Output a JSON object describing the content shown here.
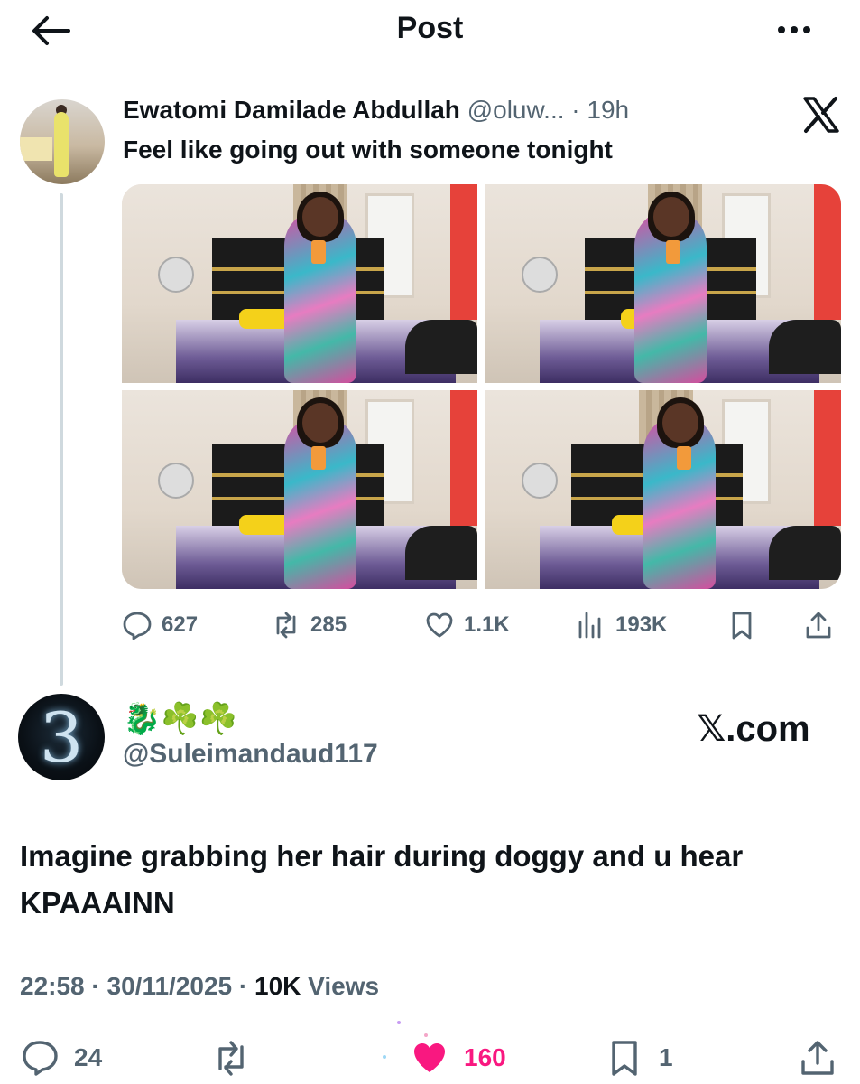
{
  "header": {
    "title": "Post",
    "back_icon": "arrow-left-icon",
    "more_icon": "more-horizontal-icon"
  },
  "quoted_post": {
    "author_name": "Ewatomi Damilade Abdullah",
    "handle_time": "@oluw... · 19h",
    "text": "Feel like going out with someone tonight",
    "source_icon": "x-logo-icon",
    "media_count": 4,
    "actions": {
      "replies": "627",
      "reposts": "285",
      "likes": "1.1K",
      "views": "193K"
    }
  },
  "reply": {
    "display_name": "🐉☘️☘️",
    "handle": "@Suleimandaud117",
    "watermark": "𝕏.com",
    "text": "Imagine grabbing her hair during doggy and u hear KPAAAINN",
    "time": "22:58",
    "date": "30/11/2025",
    "views_count": "10K",
    "views_label": "Views",
    "actions": {
      "replies": "24",
      "reposts": "",
      "likes": "160",
      "bookmarks": "1"
    },
    "like_color": "#f91880"
  },
  "colors": {
    "text": "#0f1419",
    "secondary": "#536471",
    "thread_line": "#cfd9de"
  }
}
